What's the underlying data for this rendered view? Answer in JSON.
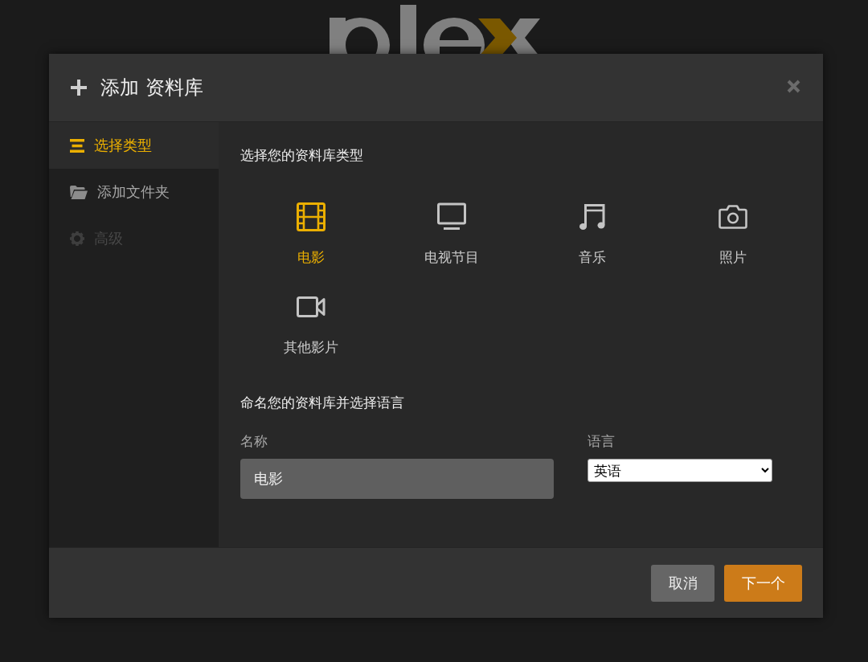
{
  "dialog": {
    "title": "添加 资料库",
    "steps": [
      {
        "label": "选择类型",
        "kind": "type",
        "selected": true,
        "disabled": false
      },
      {
        "label": "添加文件夹",
        "kind": "folder",
        "selected": false,
        "disabled": false
      },
      {
        "label": "高级",
        "kind": "advanced",
        "selected": false,
        "disabled": true
      }
    ],
    "type_section": {
      "heading": "选择您的资料库类型",
      "types": [
        {
          "label": "电影",
          "kind": "movie",
          "selected": true
        },
        {
          "label": "电视节目",
          "kind": "tv",
          "selected": false
        },
        {
          "label": "音乐",
          "kind": "music",
          "selected": false
        },
        {
          "label": "照片",
          "kind": "photo",
          "selected": false
        },
        {
          "label": "其他影片",
          "kind": "video",
          "selected": false
        }
      ]
    },
    "name_section": {
      "heading": "命名您的资料库并选择语言",
      "name_field": {
        "label": "名称",
        "value": "电影"
      },
      "language_field": {
        "label": "语言",
        "value": "英语"
      }
    },
    "buttons": [
      {
        "label": "取消",
        "kind": "secondary"
      },
      {
        "label": "下一个",
        "kind": "primary"
      }
    ]
  }
}
